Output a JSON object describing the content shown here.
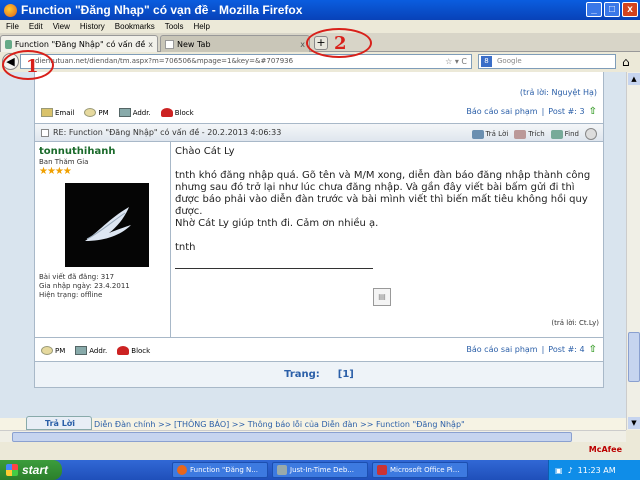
{
  "window": {
    "title": "Function \"Đăng Nhạp\" có vạn đề - Mozilla Firefox",
    "btn_min": "_",
    "btn_max": "□",
    "btn_close": "x"
  },
  "menu": [
    "File",
    "Edit",
    "View",
    "History",
    "Bookmarks",
    "Tools",
    "Help"
  ],
  "tabs": {
    "active_label": "Function \"Đăng Nhập\" có vấn đề",
    "inactive_label": "New Tab",
    "close": "x",
    "new_tab": "+"
  },
  "nav": {
    "url": "dientutuan.net/diendan/tm.aspx?m=706506&mpage=1&key=&#707936",
    "search_placeholder": "Google",
    "search_engine": "8",
    "url_glyphs": "☆ ▾ C"
  },
  "prev_post": {
    "reply_by": "(trả lời: Nguyệt Hạ)",
    "actions": [
      "Email",
      "PM",
      "Addr.",
      "Block"
    ],
    "report": "Báo cáo sai phạm",
    "post_num": "Post #: 3"
  },
  "post": {
    "header": "RE: Function \"Đăng Nhập\" có vấn đề - 20.2.2013 4:06:33",
    "header_actions": [
      "Trả Lời",
      "Trích",
      "Find"
    ],
    "username": "tonnuthihanh",
    "rank": "Ban Thăm Gia",
    "stars": "★★★★",
    "stats": [
      "Bài viết đã đăng: 317",
      "Gia nhập ngày: 23.4.2011",
      "Hiện trạng: offline"
    ],
    "greeting": "Chào Cát Ly",
    "body": "tnth khó đăng nhập quá. Gõ tên và M/M xong, diễn đàn báo đăng nhập thành công nhưng sau đó trở lại như lúc chưa đăng nhập. Và gần đây viết bài bấm gửi đi thì được báo phải vào diễn đàn trước và bài mình viết thì biến mất tiêu không hồi quy được.",
    "thanks": "Nhờ Cát Ly giúp tnth đi. Cảm ơn nhiều ạ.",
    "sign": "tnth",
    "edited_by": "(trả lời: Ct.Ly)",
    "footer_actions": [
      "PM",
      "Addr.",
      "Block"
    ],
    "report": "Báo cáo sai phạm",
    "post_num": "Post #: 4"
  },
  "pager": {
    "label": "Trang:",
    "current": "[1]"
  },
  "breadcrumb": {
    "reply_tab": "Trả Lời",
    "trail": "Diễn Đàn chính >> [THÔNG BÁO] >> Thông báo lỗi của Diễn đàn >> Function \"Đăng Nhập\""
  },
  "status": {
    "mcafee": "McAfee"
  },
  "taskbar": {
    "start": "start",
    "tasks": [
      {
        "label": "Function \"Đăng N...",
        "color": "#e8661c"
      },
      {
        "label": "Just-In-Time Deb...",
        "color": "#9aa"
      },
      {
        "label": "Microsoft Office Pi...",
        "color": "#c33"
      }
    ],
    "clock": "11:23 AM"
  },
  "annotations": [
    "1",
    "2"
  ]
}
